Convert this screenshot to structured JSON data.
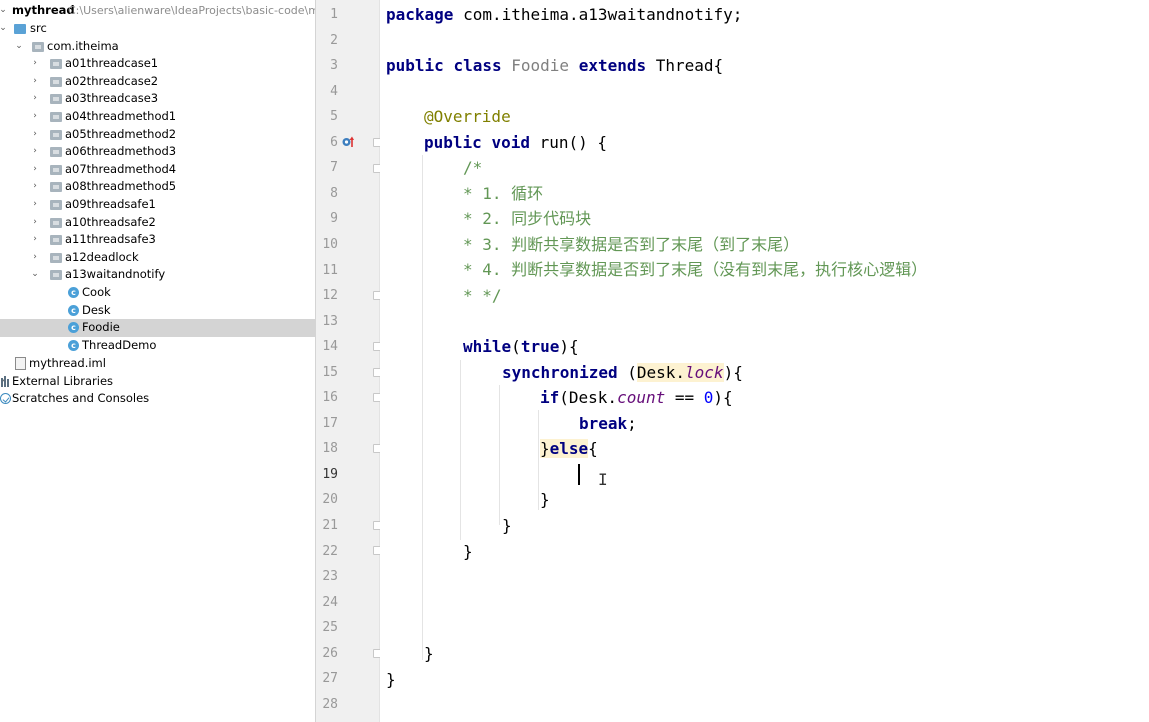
{
  "project": {
    "root_name": "mythread",
    "root_path": "C:\\Users\\alienware\\IdeaProjects\\basic-code\\myt",
    "src": "src",
    "package": "com.itheima",
    "subpackages": [
      "a01threadcase1",
      "a02threadcase2",
      "a03threadcase3",
      "a04threadmethod1",
      "a05threadmethod2",
      "a06threadmethod3",
      "a07threadmethod4",
      "a08threadmethod5",
      "a09threadsafe1",
      "a10threadsafe2",
      "a11threadsafe3",
      "a12deadlock",
      "a13waitandnotify"
    ],
    "classes": [
      "Cook",
      "Desk",
      "Foodie",
      "ThreadDemo"
    ],
    "selected_class": "Foodie",
    "iml_file": "mythread.iml",
    "external_libraries": "External Libraries",
    "scratches": "Scratches and Consoles"
  },
  "editor": {
    "line_numbers": [
      "1",
      "2",
      "3",
      "4",
      "5",
      "6",
      "7",
      "8",
      "9",
      "10",
      "11",
      "12",
      "13",
      "14",
      "15",
      "16",
      "17",
      "18",
      "19",
      "20",
      "21",
      "22",
      "23",
      "24",
      "25",
      "26",
      "27",
      "28"
    ],
    "current_line": "19",
    "code": {
      "l1_package_kw": "package",
      "l1_package_name": " com.itheima.a13waitandnotify;",
      "l3_public": "public",
      "l3_class": "class",
      "l3_classname": "Foodie",
      "l3_extends": "extends",
      "l3_super": " Thread{",
      "l5_annotation": "@Override",
      "l6_public": "public",
      "l6_void": "void",
      "l6_rest": " run() {",
      "l7": "/*",
      "l8": "* 1. 循环",
      "l9": "* 2. 同步代码块",
      "l10": "* 3. 判断共享数据是否到了末尾（到了末尾）",
      "l11": "* 4. 判断共享数据是否到了末尾（没有到末尾，执行核心逻辑）",
      "l12": "* */",
      "l14_while": "while",
      "l14_paren": "(",
      "l14_true": "true",
      "l14_rest": "){",
      "l15_sync": "synchronized",
      "l15_open": " (",
      "l15_desk": "Desk.",
      "l15_lock": "lock",
      "l15_close": "){",
      "l16_if": "if",
      "l16_desk": "(Desk.",
      "l16_count": "count",
      "l16_eq": " == ",
      "l16_zero": "0",
      "l16_close": "){",
      "l17_break": "break",
      "l17_semi": ";",
      "l18_brace": "}",
      "l18_else": "else",
      "l18_open": "{",
      "l20": "}",
      "l21": "}",
      "l22": "}",
      "l26": "}",
      "l27": "}"
    }
  },
  "colors": {
    "keyword": "#000080",
    "comment": "#629755",
    "annotation": "#808000",
    "field": "#660e7a",
    "number": "#0000ff",
    "selection": "#d4d4d4"
  }
}
